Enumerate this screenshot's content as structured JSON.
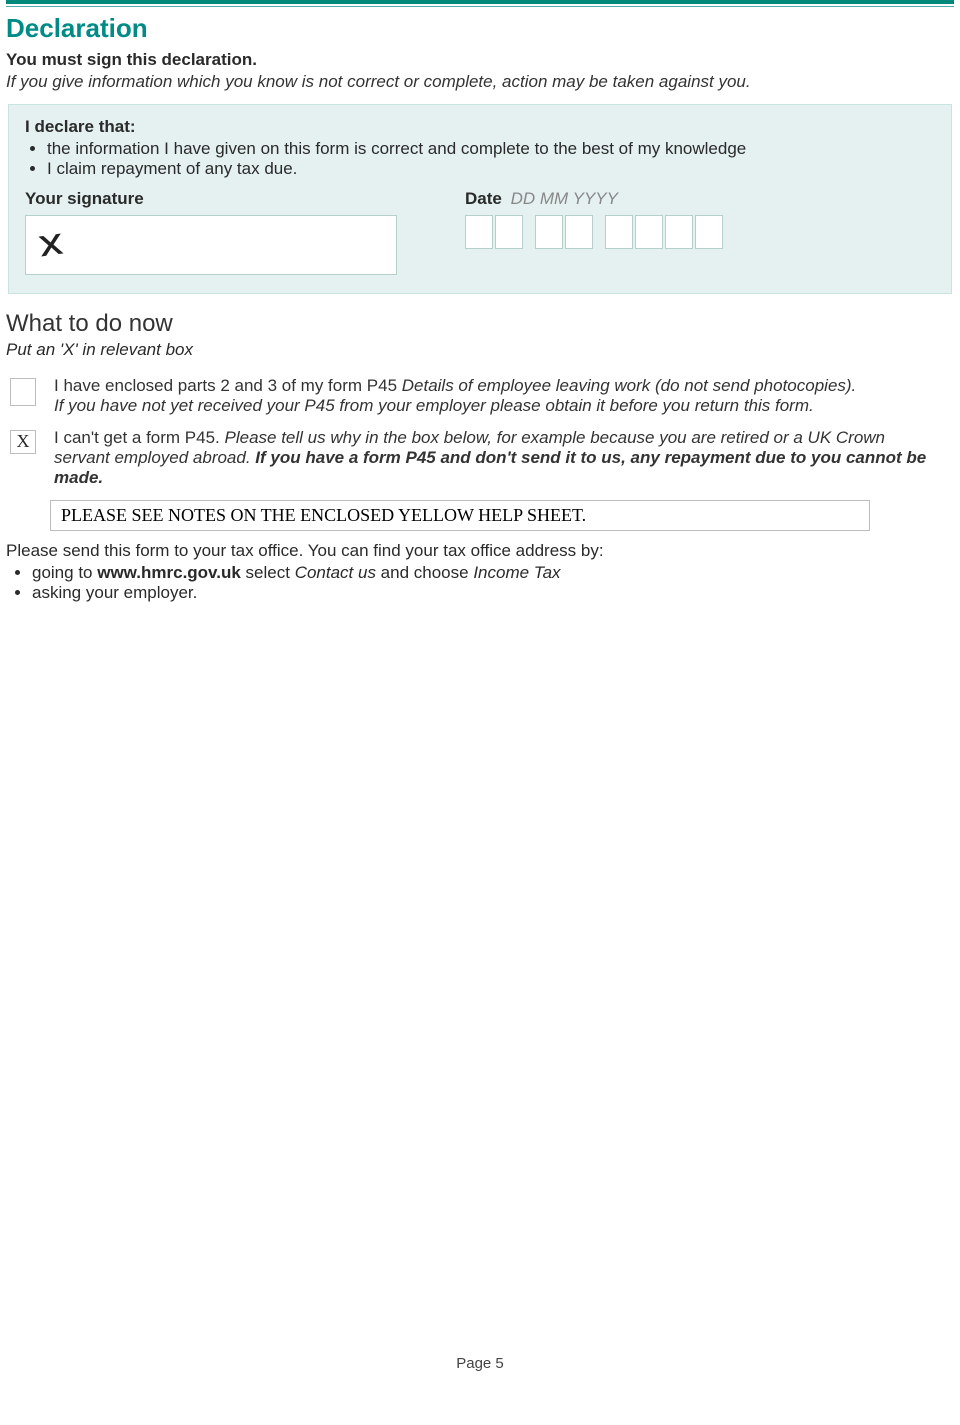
{
  "header": {
    "title": "Declaration",
    "mustSign": "You must sign this declaration.",
    "warning": "If you give information which you know is not correct or complete, action may be taken against you."
  },
  "declaration": {
    "heading": "I declare that:",
    "bullet1": "the information I have given on this form is correct and complete to the best of my knowledge",
    "bullet2": "I claim repayment of any tax due.",
    "sigLabel": "Your signature",
    "dateLabel": "Date",
    "dateHint": "DD MM YYYY"
  },
  "nextSteps": {
    "title": "What to do now",
    "instruction": "Put an 'X' in relevant box",
    "option1": {
      "checked": "",
      "text_a": "I have enclosed parts 2 and 3 of my form P45 ",
      "text_b_italic": "Details of employee leaving work (do not send photocopies).",
      "text_c_italic": "If you have not yet received your P45 from your employer please obtain it before you return this form."
    },
    "option2": {
      "checked": "X",
      "text_a": "I can't get a form P45. ",
      "text_b_italic": "Please tell us why in the box below, for example because you are retired or a UK Crown servant employed abroad. ",
      "text_c_boldital": "If you have a form P45 and don't send it to us, any repayment due to you cannot be made."
    },
    "reasonEntered": "PLEASE SEE NOTES ON THE ENCLOSED YELLOW HELP SHEET."
  },
  "sendInfo": {
    "intro": "Please send this form to your tax office. You can find your tax office address by:",
    "b1_a": "going to ",
    "b1_link": "www.hmrc.gov.uk",
    "b1_b": " select ",
    "b1_c_italic": "Contact us",
    "b1_d": " and choose ",
    "b1_e_italic": "Income Tax",
    "b2": "asking your employer."
  },
  "footer": {
    "page": "Page 5"
  }
}
